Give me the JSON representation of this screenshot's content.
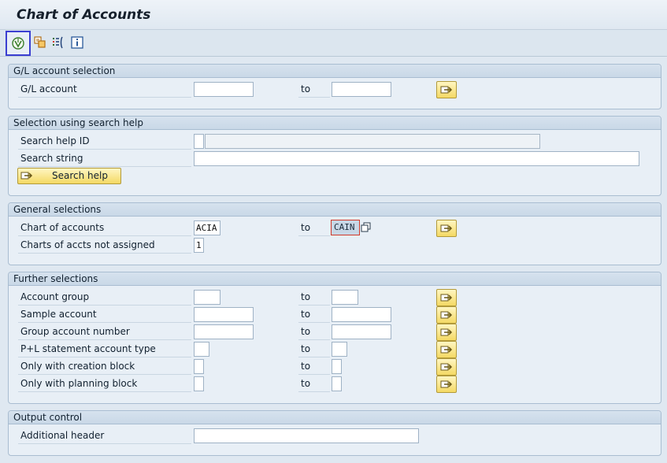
{
  "title": "Chart of Accounts",
  "toolbar": {
    "execute_icon": "execute-icon",
    "variant_icon": "get-variant-icon",
    "selection_options_icon": "selection-options-icon",
    "info_icon": "info-icon"
  },
  "gl_section": {
    "heading": "G/L account selection",
    "gl_account_label": "G/L account",
    "to_label": "to",
    "from_value": "",
    "to_value": ""
  },
  "search_help_section": {
    "heading": "Selection using search help",
    "search_help_id_label": "Search help ID",
    "search_string_label": "Search string",
    "search_help_id_value": "",
    "search_help_desc_value": "",
    "search_string_value": "",
    "search_help_button": "Search help"
  },
  "general_section": {
    "heading": "General selections",
    "chart_label": "Chart of accounts",
    "to_label": "to",
    "chart_from_value": "ACIA",
    "chart_to_value": "CAIN",
    "not_assigned_label": "Charts of accts not assigned",
    "not_assigned_value": "1"
  },
  "further_section": {
    "heading": "Further selections",
    "to_label": "to",
    "rows": [
      {
        "label": "Account group",
        "from": "",
        "to": ""
      },
      {
        "label": "Sample account",
        "from": "",
        "to": ""
      },
      {
        "label": "Group account number",
        "from": "",
        "to": ""
      },
      {
        "label": "P+L statement account type",
        "from": "",
        "to": ""
      },
      {
        "label": "Only with creation block",
        "from": "",
        "to": ""
      },
      {
        "label": "Only with planning block",
        "from": "",
        "to": ""
      }
    ]
  },
  "output_section": {
    "heading": "Output control",
    "additional_header_label": "Additional header",
    "additional_header_value": ""
  },
  "colors": {
    "background": "#dfe8f1",
    "group_border": "#a9bdd1",
    "button_yellow": "#f4d964",
    "focus_red": "#d03a2a",
    "toolbar_highlight": "#3b3fd1"
  }
}
